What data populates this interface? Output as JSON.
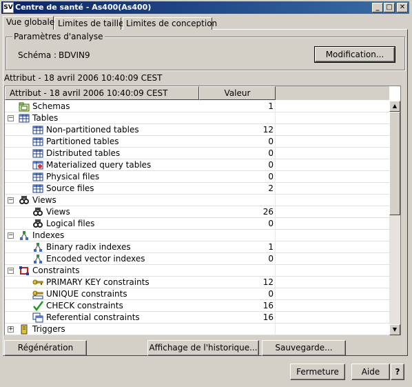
{
  "window": {
    "title": "Centre de santé - As400(As400)",
    "app_icon": "SV",
    "controls": {
      "minimize": "_",
      "maximize": "□",
      "close": "✕"
    }
  },
  "tabs": [
    {
      "label": "Vue globale",
      "active": true
    },
    {
      "label": "Limites de taille",
      "active": false
    },
    {
      "label": "Limites de conception",
      "active": false
    }
  ],
  "analysis": {
    "legend": "Paramètres d'analyse",
    "schema_label": "Schéma :",
    "schema_value": "BDVIN9",
    "modify_label": "Modification..."
  },
  "attribute_label": "Attribut - 18 avril 2006 10:40:09 CEST",
  "table": {
    "columns": [
      "Attribut - 18 avril 2006 10:40:09 CEST",
      "Valeur"
    ],
    "rows": [
      {
        "label": "Schemas",
        "value": "1",
        "level": 0,
        "expander": "",
        "icon": "schema-folder-icon"
      },
      {
        "label": "Tables",
        "value": "",
        "level": 0,
        "expander": "−",
        "icon": "table-icon"
      },
      {
        "label": "Non-partitioned tables",
        "value": "12",
        "level": 1,
        "expander": "",
        "icon": "table-icon"
      },
      {
        "label": "Partitioned tables",
        "value": "0",
        "level": 1,
        "expander": "",
        "icon": "table-icon"
      },
      {
        "label": "Distributed tables",
        "value": "0",
        "level": 1,
        "expander": "",
        "icon": "table-icon"
      },
      {
        "label": "Materialized query tables",
        "value": "0",
        "level": 1,
        "expander": "",
        "icon": "materialized-table-icon"
      },
      {
        "label": "Physical files",
        "value": "0",
        "level": 1,
        "expander": "",
        "icon": "table-icon"
      },
      {
        "label": "Source files",
        "value": "2",
        "level": 1,
        "expander": "",
        "icon": "table-icon"
      },
      {
        "label": "Views",
        "value": "",
        "level": 0,
        "expander": "−",
        "icon": "glasses-view-icon"
      },
      {
        "label": "Views",
        "value": "26",
        "level": 1,
        "expander": "",
        "icon": "glasses-view-icon"
      },
      {
        "label": "Logical files",
        "value": "0",
        "level": 1,
        "expander": "",
        "icon": "glasses-view-icon"
      },
      {
        "label": "Indexes",
        "value": "",
        "level": 0,
        "expander": "−",
        "icon": "index-tree-icon"
      },
      {
        "label": "Binary radix indexes",
        "value": "1",
        "level": 1,
        "expander": "",
        "icon": "index-tree-icon"
      },
      {
        "label": "Encoded vector indexes",
        "value": "0",
        "level": 1,
        "expander": "",
        "icon": "index-tree-icon"
      },
      {
        "label": "Constraints",
        "value": "",
        "level": 0,
        "expander": "−",
        "icon": "constraint-icon"
      },
      {
        "label": "PRIMARY KEY constraints",
        "value": "12",
        "level": 1,
        "expander": "",
        "icon": "key-icon"
      },
      {
        "label": "UNIQUE constraints",
        "value": "0",
        "level": 1,
        "expander": "",
        "icon": "unique-key-icon"
      },
      {
        "label": "CHECK constraints",
        "value": "16",
        "level": 1,
        "expander": "",
        "icon": "checkmark-icon"
      },
      {
        "label": "Referential constraints",
        "value": "16",
        "level": 1,
        "expander": "",
        "icon": "referential-icon"
      },
      {
        "label": "Triggers",
        "value": "",
        "level": 0,
        "expander": "+",
        "icon": "trigger-icon"
      }
    ]
  },
  "scrollbar": {
    "up": "▲",
    "down": "▼"
  },
  "buttons": {
    "regenerate": "Régénération",
    "history": "Affichage de l'historique...",
    "save": "Sauvegarde...",
    "close": "Fermeture",
    "help": "Aide",
    "question": "?"
  }
}
